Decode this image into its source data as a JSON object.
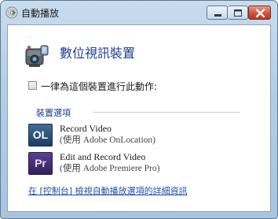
{
  "window": {
    "title": "自動播放",
    "icon": "autoplay-cd-icon",
    "controls": {
      "minimize": "minimize-icon",
      "maximize": "maximize-icon",
      "close": "close-icon"
    }
  },
  "device": {
    "icon": "video-camera-icon",
    "name": "數位視訊裝置"
  },
  "always_checkbox": {
    "label": "一律為這個裝置進行此動作:",
    "checked": false
  },
  "options_group": {
    "title": "裝置選項",
    "items": [
      {
        "app_icon_text": "OL",
        "icon": "adobe-onlocation-icon",
        "title": "Record Video",
        "subtitle": "(使用 Adobe OnLocation)"
      },
      {
        "app_icon_text": "Pr",
        "icon": "adobe-premiere-pro-icon",
        "title": "Edit and Record Video",
        "subtitle": "(使用 Adobe Premiere Pro)"
      }
    ]
  },
  "footer_link": "在 [控制台] 檢視自動播放選項的詳細資訊",
  "colors": {
    "heading_blue": "#1e3d8f",
    "link_blue": "#1f4fa8",
    "close_red": "#c7432c",
    "frame_blue": "#b6cde4"
  }
}
